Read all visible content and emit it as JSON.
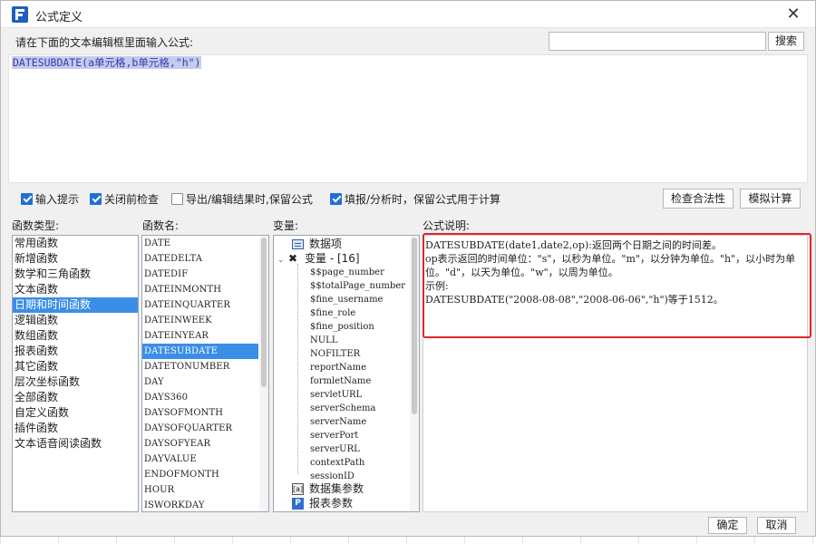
{
  "window": {
    "title": "公式定义"
  },
  "editor": {
    "prompt": "请在下面的文本编辑框里面输入公式:",
    "formula": "DATESUBDATE(a单元格,b单元格,\"h\")"
  },
  "search": {
    "value": "",
    "placeholder": "",
    "button_label": "搜索"
  },
  "options": [
    {
      "label": "输入提示",
      "checked": true
    },
    {
      "label": "关闭前检查",
      "checked": true
    },
    {
      "label": "导出/编辑结果时,保留公式",
      "checked": false
    },
    {
      "label": "填报/分析时，保留公式用于计算",
      "checked": true
    }
  ],
  "buttons": {
    "check": "检查合法性",
    "simulate": "模拟计算",
    "ok": "确定",
    "cancel": "取消"
  },
  "labels": {
    "categories": "函数类型:",
    "functions": "函数名:",
    "variables": "变量:",
    "description": "公式说明:"
  },
  "categories": [
    "常用函数",
    "新增函数",
    "数学和三角函数",
    "文本函数",
    "日期和时间函数",
    "逻辑函数",
    "数组函数",
    "报表函数",
    "其它函数",
    "层次坐标函数",
    "全部函数",
    "自定义函数",
    "插件函数",
    "文本语音阅读函数"
  ],
  "selected_category": "日期和时间函数",
  "functions": [
    "DATE",
    "DATEDELTA",
    "DATEDIF",
    "DATEINMONTH",
    "DATEINQUARTER",
    "DATEINWEEK",
    "DATEINYEAR",
    "DATESUBDATE",
    "DATETONUMBER",
    "DAY",
    "DAYS360",
    "DAYSOFMONTH",
    "DAYSOFQUARTER",
    "DAYSOFYEAR",
    "DAYVALUE",
    "ENDOFMONTH",
    "HOUR",
    "ISWORKDAY"
  ],
  "selected_function": "DATESUBDATE",
  "variables": {
    "data_items": "数据项",
    "var_group": "变量 - [16]",
    "var_items": [
      "$$page_number",
      "$$totalPage_number",
      "$fine_username",
      "$fine_role",
      "$fine_position",
      "NULL",
      "NOFILTER",
      "reportName",
      "formletName",
      "servletURL",
      "serverSchema",
      "serverName",
      "serverPort",
      "serverURL",
      "contextPath",
      "sessionID"
    ],
    "dataset_params": "数据集参数",
    "report_params": "报表参数",
    "ds_icon_text": "[a]",
    "p_icon_text": "P",
    "var_icon_text": "✖"
  },
  "description": {
    "lines": [
      "DATESUBDATE(date1,date2,op):返回两个日期之间的时间差。",
      "op表示返回的时间单位：\"s\"，以秒为单位。\"m\"，以分钟为单位。\"h\"，以小时为单位。\"d\"，以天为单位。\"w\"，以周为单位。",
      "示例:",
      "DATESUBDATE(\"2008-08-08\",\"2008-06-06\",\"h\")等于1512。"
    ]
  },
  "colors": {
    "selection": "#3b8ee6",
    "highlight_border": "#e0262d",
    "editor_selection": "#c3cbef"
  }
}
